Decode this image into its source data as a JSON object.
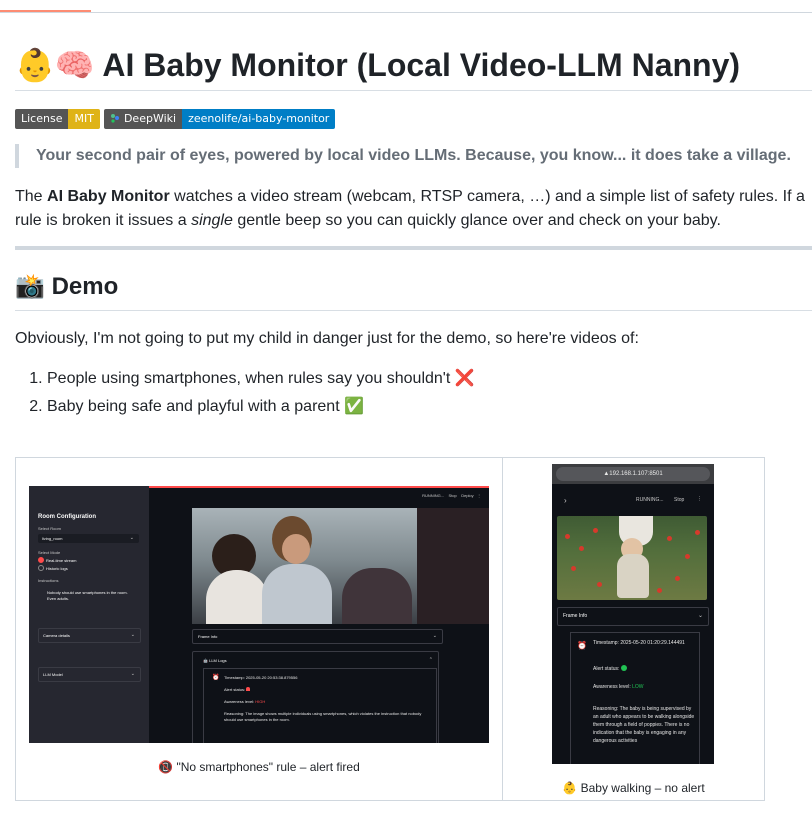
{
  "header": {
    "title_emoji": "👶🧠",
    "title": "AI Baby Monitor (Local Video-LLM Nanny)"
  },
  "badges": [
    {
      "label": "License",
      "value": "MIT"
    },
    {
      "label": "DeepWiki",
      "value": "zeenolife/ai-baby-monitor"
    }
  ],
  "tagline": "Your second pair of eyes, powered by local video LLMs. Because, you know... it does take a village.",
  "intro": {
    "before_bold": "The ",
    "bold": "AI Baby Monitor",
    "mid": " watches a video stream (webcam, RTSP camera, …) and a simple list of safety rules. If a rule is broken it issues a ",
    "italic": "single",
    "after": " gentle beep so you can quickly glance over and check on your baby."
  },
  "demo": {
    "heading_emoji": "📸",
    "heading": "Demo",
    "intro": "Obviously, I'm not going to put my child in danger just for the demo, so here're videos of:",
    "items": [
      {
        "text": "People using smartphones, when rules say you shouldn't",
        "mark": "❌"
      },
      {
        "text": "Baby being safe and playful with a parent",
        "mark": "✅"
      }
    ],
    "videos": [
      {
        "caption": "📵 \"No smartphones\" rule – alert fired",
        "app": {
          "sidebar_title": "Room Configuration",
          "select_room_label": "Select Room",
          "room_value": "living_room",
          "select_mode_label": "Select Mode",
          "mode_options": [
            "Real-time stream",
            "Historic logs"
          ],
          "instructions_label": "Instructions",
          "instruction": "Nobody should use smartphones in the room. Even adults.",
          "camera_details": "Camera details",
          "llm_model": "LLM Model",
          "status_running": "RUNNING...",
          "stop": "Stop",
          "deploy": "Deploy",
          "frame_info": "Frame Info",
          "llm_logs": "🤖 LLM Logs",
          "timestamp": "Timestamp: 2025-05-20 20:53:38.879556",
          "alert_status": "Alert status:",
          "awareness_label": "Awareness level:",
          "awareness_value": "HIGH",
          "reasoning": "Reasoning: The image shows multiple individuals using smartphones, which violates the instruction that nobody should use smartphones in the room."
        }
      },
      {
        "caption": "👶 Baby walking – no alert",
        "app": {
          "url": "192.168.1.107:8501",
          "status_running": "RUNNING...",
          "stop": "Stop",
          "frame_info": "Frame Info",
          "timestamp": "Timestamp: 2025-05-20 01:20:29.144491",
          "alert_status": "Alert status:",
          "awareness_label": "Awareness level:",
          "awareness_value": "LOW",
          "reasoning": "Reasoning: The baby is being supervised by an adult who appears to be walking alongside them through a field of poppies. There is no indication that the baby is engaging in any dangerous activities"
        }
      }
    ]
  },
  "colors": {
    "accent_tab": "#fd8c73",
    "badge_mit": "#dfb317",
    "badge_deepwiki": "#007ec6",
    "streamlit_red": "#ff4b4b",
    "low_green": "#21c354"
  }
}
